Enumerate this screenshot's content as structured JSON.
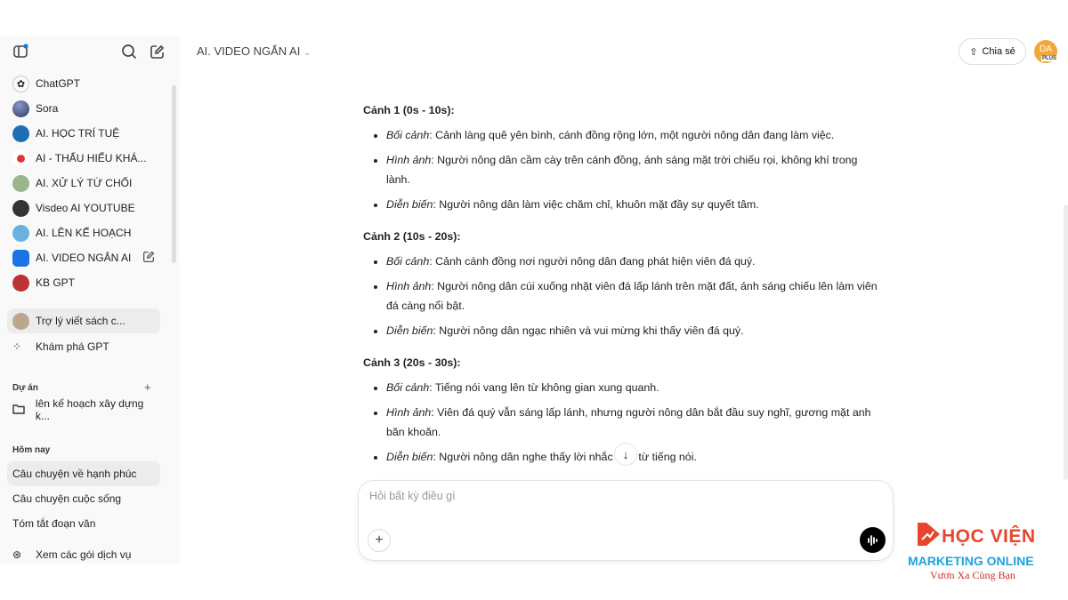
{
  "sidebar": {
    "gpts": [
      {
        "label": "ChatGPT",
        "color": "#ffffff"
      },
      {
        "label": "Sora",
        "color": "#4a5a8a"
      },
      {
        "label": "AI. HỌC TRÍ TUỆ",
        "color": "#1f6fb5"
      },
      {
        "label": "AI - THẤU HIỂU KHÁ...",
        "color": "#d33"
      },
      {
        "label": "AI. XỬ LÝ TỪ CHỐI",
        "color": "#9bb58a"
      },
      {
        "label": "Visdeo AI YOUTUBE",
        "color": "#333"
      },
      {
        "label": "AI. LÊN KẾ HOẠCH",
        "color": "#6ab0e0"
      },
      {
        "label": "AI. VIDEO NGẮN AI",
        "color": "#1a73e8"
      },
      {
        "label": "KB GPT",
        "color": "#b33"
      },
      {
        "label": "Trợ lý viết sách c...",
        "color": "#b9a88e"
      }
    ],
    "explore": "Khám phá GPT",
    "projects_heading": "Dự án",
    "project": "lên kế hoạch xây dựng k...",
    "today_heading": "Hôm nay",
    "chats": [
      "Câu chuyện về hạnh phúc",
      "Câu chuyện cuộc sống",
      "Tóm tắt đoạn văn"
    ],
    "upgrade": "Xem các gói dịch vụ"
  },
  "header": {
    "title": "AI. VIDEO NGẮN AI",
    "share": "Chia sẻ",
    "avatar": "DA",
    "badge": "PLUS"
  },
  "scenes": [
    {
      "title": "Cảnh 1 (0s - 10s):",
      "items": [
        {
          "k": "Bối cảnh",
          "v": ": Cảnh làng quê yên bình, cánh đồng rộng lớn, một người nông dân đang làm việc."
        },
        {
          "k": "Hình ảnh",
          "v": ": Người nông dân cầm cày trên cánh đồng, ánh sáng mặt trời chiếu rọi, không khí trong lành."
        },
        {
          "k": "Diễn biến",
          "v": ": Người nông dân làm việc chăm chỉ, khuôn mặt đầy sự quyết tâm."
        }
      ]
    },
    {
      "title": "Cảnh 2 (10s - 20s):",
      "items": [
        {
          "k": "Bối cảnh",
          "v": ": Cảnh cánh đồng nơi người nông dân đang phát hiện viên đá quý."
        },
        {
          "k": "Hình ảnh",
          "v": ": Người nông dân cúi xuống nhặt viên đá lấp lánh trên mặt đất, ánh sáng chiếu lên làm viên đá càng nổi bật."
        },
        {
          "k": "Diễn biến",
          "v": ": Người nông dân ngạc nhiên và vui mừng khi thấy viên đá quý."
        }
      ]
    },
    {
      "title": "Cảnh 3 (20s - 30s):",
      "items": [
        {
          "k": "Bối cảnh",
          "v": ": Tiếng nói vang lên từ không gian xung quanh."
        },
        {
          "k": "Hình ảnh",
          "v": ": Viên đá quý vẫn sáng lấp lánh, nhưng người nông dân bắt đầu suy nghĩ, gương mặt anh băn khoăn."
        },
        {
          "k": "Diễn biến",
          "v": ": Người nông dân nghe thấy lời nhắc nhở từ tiếng nói."
        }
      ]
    }
  ],
  "composer": {
    "placeholder": "Hỏi bất kỳ điều gì"
  },
  "logo": {
    "line1": "HỌC VIỆN",
    "line2": "MARKETING ONLINE",
    "line3": "Vươn Xa Cùng Bạn",
    "colors": {
      "red": "#e8452c",
      "blue": "#1aa3e0"
    }
  }
}
